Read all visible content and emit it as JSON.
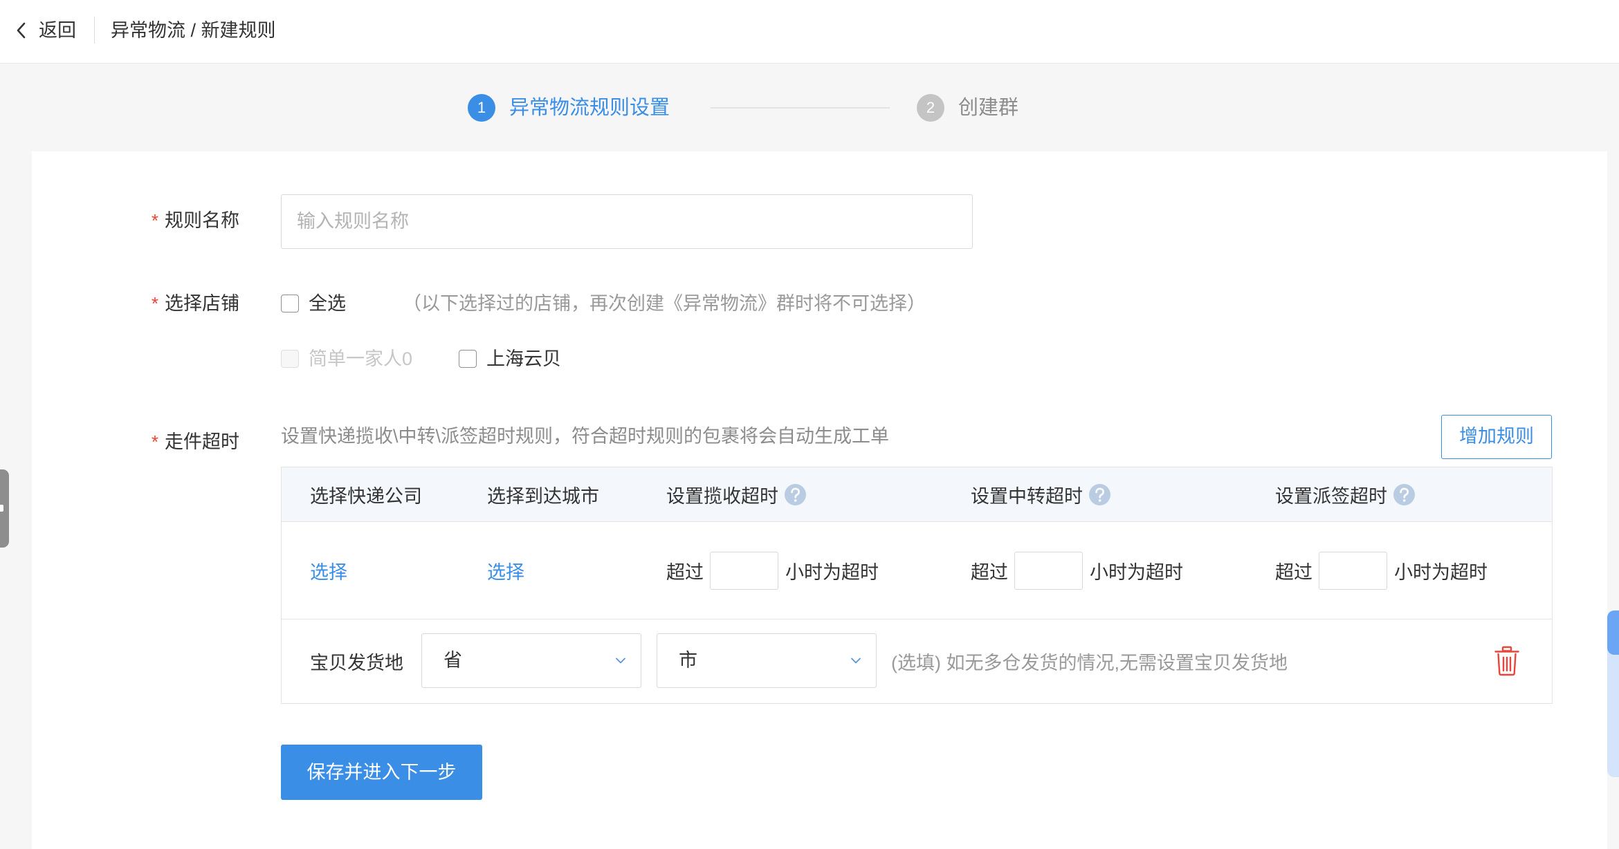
{
  "header": {
    "back_label": "返回",
    "back_icon": "chevron-left-icon",
    "breadcrumb": "异常物流 / 新建规则"
  },
  "steps": [
    {
      "number": "1",
      "label": "异常物流规则设置",
      "active": true
    },
    {
      "number": "2",
      "label": "创建群",
      "active": false
    }
  ],
  "form": {
    "required_mark": "*",
    "rule_name": {
      "label": "规则名称",
      "placeholder": "输入规则名称",
      "value": ""
    },
    "store": {
      "label": "选择店铺",
      "select_all": {
        "label": "全选",
        "checked": false
      },
      "note": "（以下选择过的店铺，再次创建《异常物流》群时将不可选择）",
      "options": [
        {
          "name": "简单一家人0",
          "checked": false,
          "disabled": true
        },
        {
          "name": "上海云贝",
          "checked": false,
          "disabled": false
        }
      ]
    },
    "timeout": {
      "label": "走件超时",
      "description": "设置快递揽收\\中转\\派签超时规则，符合超时规则的包裹将会自动生成工单",
      "add_rule_label": "增加规则",
      "columns": [
        "选择快递公司",
        "选择到达城市",
        "设置揽收超时",
        "设置中转超时",
        "设置派签超时"
      ],
      "help_icon": "question-circle-icon",
      "rules": [
        {
          "express_company": "选择",
          "destination_city": "选择",
          "timeouts": [
            {
              "prefix": "超过",
              "value": "",
              "suffix": "小时为超时"
            },
            {
              "prefix": "超过",
              "value": "",
              "suffix": "小时为超时"
            },
            {
              "prefix": "超过",
              "value": "",
              "suffix": "小时为超时"
            }
          ],
          "origin": {
            "label": "宝贝发货地",
            "province_placeholder": "省",
            "city_placeholder": "市",
            "dropdown_icon": "chevron-down-icon",
            "note": "(选填) 如无多仓发货的情况,无需设置宝贝发货地"
          },
          "delete_icon": "trash-icon"
        }
      ]
    },
    "submit_label": "保存并进入下一步"
  },
  "colors": {
    "accent": "#3a8ee6",
    "danger": "#e8453c",
    "required": "#f04134",
    "page_bg": "#f6f6f6",
    "table_header_bg": "#f4f7fb"
  }
}
